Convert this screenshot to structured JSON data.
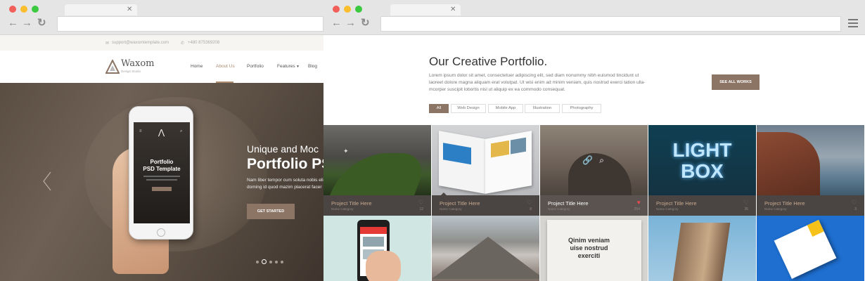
{
  "colors": {
    "accent": "#8c7565",
    "heart": "#e24a53",
    "chrome": "#e5e5e5"
  },
  "window1": {
    "topbar": {
      "email": "support@waxomtemplate.com",
      "phone": "+480 875369208"
    },
    "logo": {
      "name": "Waxom",
      "tagline": "Design Studio"
    },
    "nav": [
      "Home",
      "About Us",
      "Portfolio",
      "Features",
      "Blog"
    ],
    "hero": {
      "phone_title_1": "Portfolio",
      "phone_title_2": "PSD Template",
      "subtitle": "Unique and Moc",
      "title": "Portfolio PS",
      "text_1": "Nam liber tempor cum soluta nobis eli",
      "text_2": "doming id quod mazim placerat facer",
      "button": "GET STARTED"
    }
  },
  "window2": {
    "title": "Our Creative Portfolio.",
    "text": "Lorem ipsum dolor sit amet, consectetuer adipiscing elit, sed diam nonummy nibh euismod tincidunt ut laoreet dolore magna aliquam erat volutpat. Ut wisi enim ad minim veniam, quis nostrud exerci tation ulla-mcorper suscipit lobortis nisl ut aliquip ex ea commodo consequat.",
    "see_all": "SEE ALL WORKS",
    "filters": [
      "All",
      "Web Design",
      "Mobile App",
      "Illustration",
      "Photography"
    ],
    "projects": [
      {
        "title": "Project Title Here",
        "category": "Name Category",
        "likes": "12",
        "liked": false
      },
      {
        "title": "Project Title Here",
        "category": "Name Category",
        "likes": "8",
        "liked": false
      },
      {
        "title": "Project Title Here",
        "category": "Name Category",
        "likes": "254",
        "liked": true
      },
      {
        "title": "Project Title Here",
        "category": "Name Category",
        "likes": "35",
        "liked": false
      },
      {
        "title": "Project Title Here",
        "category": "Name Category",
        "likes": "3",
        "liked": false
      }
    ],
    "lightbox_1": "LIGHT",
    "lightbox_2": "BOX",
    "book_1": "Qinim veniam",
    "book_2": "uise nostrud",
    "book_3": "exerciti"
  }
}
